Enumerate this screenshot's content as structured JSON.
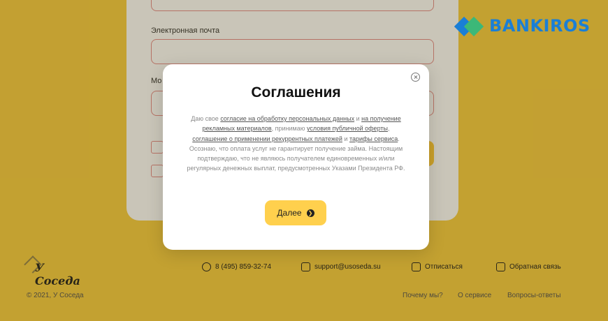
{
  "form": {
    "email_label": "Электронная почта",
    "phone_label_partial": "Мо"
  },
  "footer": {
    "logo_text": "У Соседа",
    "phone": "8 (495) 859-32-74",
    "email": "support@usoseda.su",
    "unsubscribe": "Отписаться",
    "feedback": "Обратная связь",
    "copyright": "© 2021, У Соседа",
    "links": [
      "Почему мы?",
      "О сервисе",
      "Вопросы-ответы"
    ]
  },
  "watermark": {
    "text": "BANKIROS"
  },
  "modal": {
    "title": "Соглашения",
    "t1": "Даю свое ",
    "l1": "согласие на обработку персональных данных",
    "t2": " и ",
    "l2": "на получение рекламных материалов",
    "t3": ", принимаю ",
    "l3": "условия публичной оферты",
    "t4": ", ",
    "l4": "соглашение о применении рекуррентных платежей",
    "t5": " и ",
    "l5": "тарифы сервиса",
    "t6": ". Осознаю, что оплата услуг не гарантирует получение займа. Настоящим подтверждаю, что не являюсь получателем единовременных и/или регулярных денежных выплат, предусмотренных Указами Президента РФ.",
    "next_label": "Далее"
  },
  "colors": {
    "page_bg": "#f7cd45",
    "button": "#ffd04d",
    "field_border": "#e58c8c",
    "brand_blue": "#1a7fd6",
    "brand_green": "#3cb878"
  }
}
